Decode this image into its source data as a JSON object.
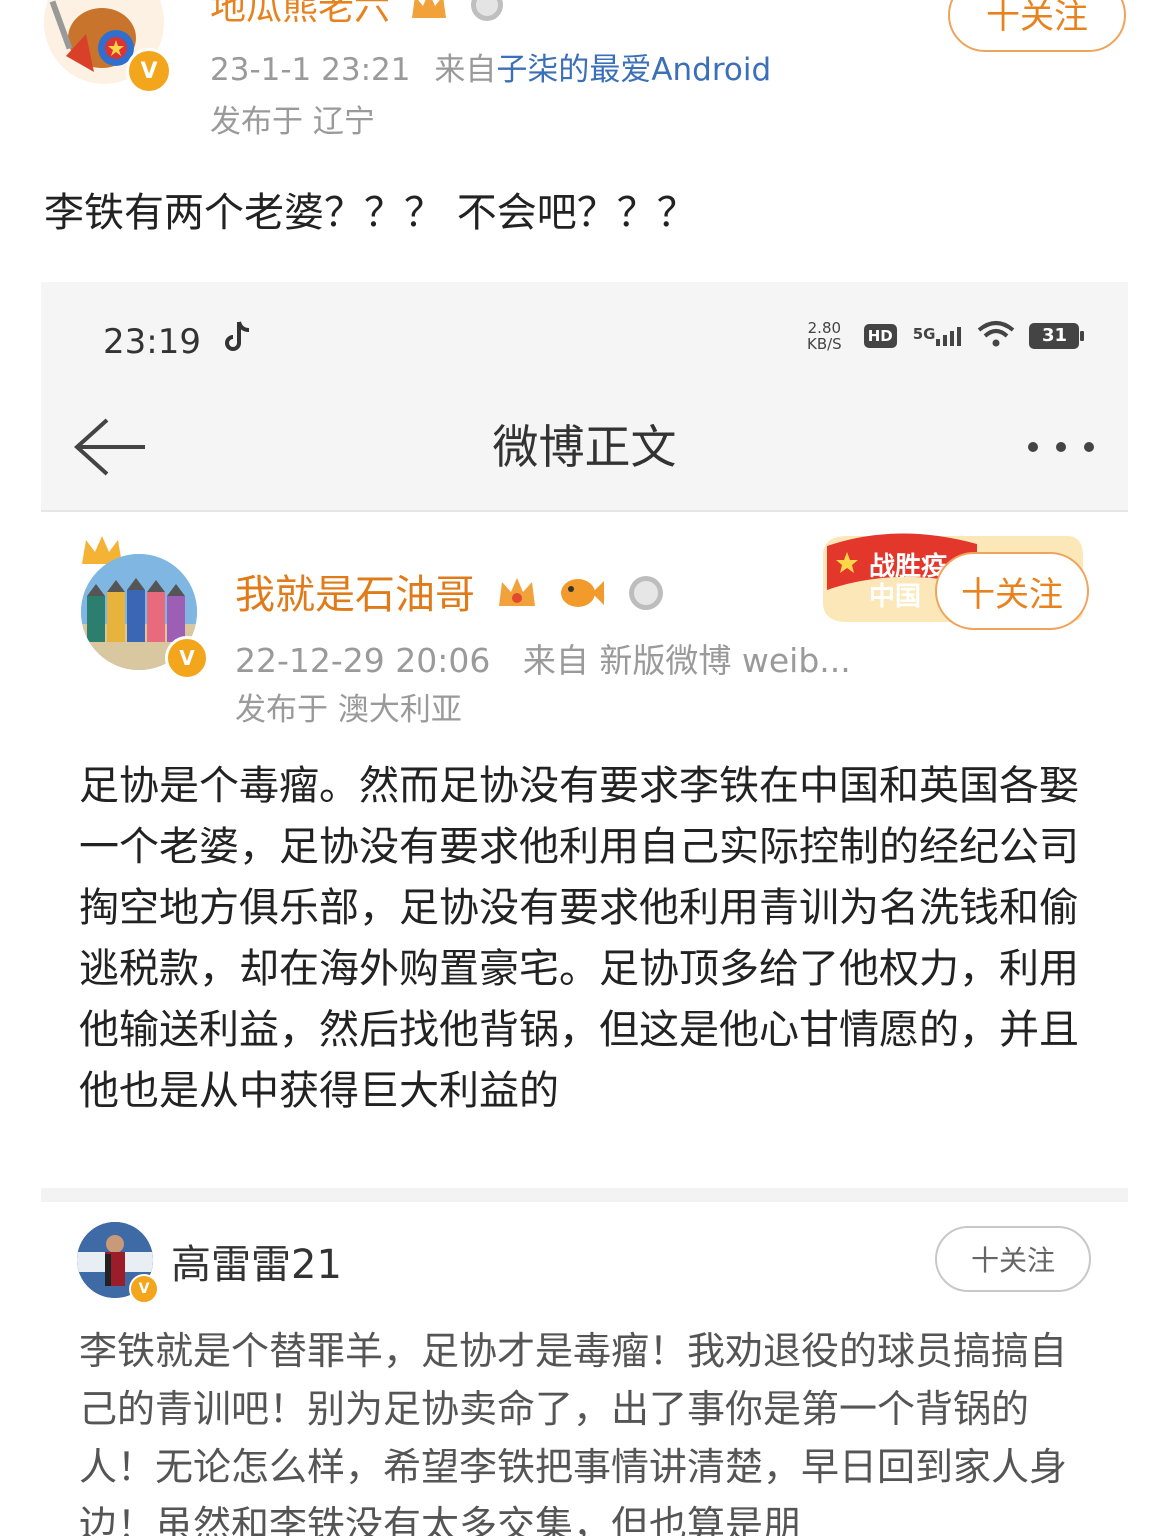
{
  "outer_post": {
    "author": "地瓜熊老六",
    "follow_label": "十关注",
    "time": "23-1-1 23:21",
    "source_prefix": "来自",
    "source": "子柒的最爱Android",
    "location": "发布于 辽宁",
    "text": "李铁有两个老婆？？？ 不会吧？？？"
  },
  "screenshot": {
    "status_bar": {
      "time": "23:19",
      "net_speed_top": "2.80",
      "net_speed_bottom": "KB/S",
      "hd_label": "HD",
      "network_label": "5G",
      "battery": "31"
    },
    "nav": {
      "title": "微博正文"
    },
    "post": {
      "author": "我就是石油哥",
      "badge_text_line1": "战胜疫",
      "badge_text_line2": "中国",
      "follow_label": "十关注",
      "time": "22-12-29 20:06",
      "source": "来自 新版微博 weib...",
      "location": "发布于 澳大利亚",
      "text": "足协是个毒瘤。然而足协没有要求李铁在中国和英国各娶一个老婆，足协没有要求他利用自己实际控制的经纪公司掏空地方俱乐部，足协没有要求他利用青训为名洗钱和偷逃税款，却在海外购置豪宅。足协顶多给了他权力，利用他输送利益，然后找他背锅，但这是他心甘情愿的，并且他也是从中获得巨大利益的"
    },
    "comment": {
      "author": "高雷雷21",
      "follow_label": "十关注",
      "text": "李铁就是个替罪羊，足协才是毒瘤！我劝退役的球员搞搞自己的青训吧！别为足协卖命了，出了事你是第一个背锅的人！无论怎么样，希望李铁把事情讲清楚，早日回到家人身边！虽然和李铁没有太多交集，但也算是朋"
    }
  },
  "colors": {
    "accent_orange": "#e8821e",
    "link_blue": "#3b6fb8",
    "meta_gray": "#9a9a9a",
    "verified_badge": "#f3a51c"
  },
  "icons": [
    "crown-icon",
    "medal-icon",
    "verified-icon",
    "back-arrow-icon",
    "more-icon",
    "tiktok-icon",
    "wifi-icon",
    "signal-icon",
    "battery-icon",
    "fish-icon"
  ]
}
